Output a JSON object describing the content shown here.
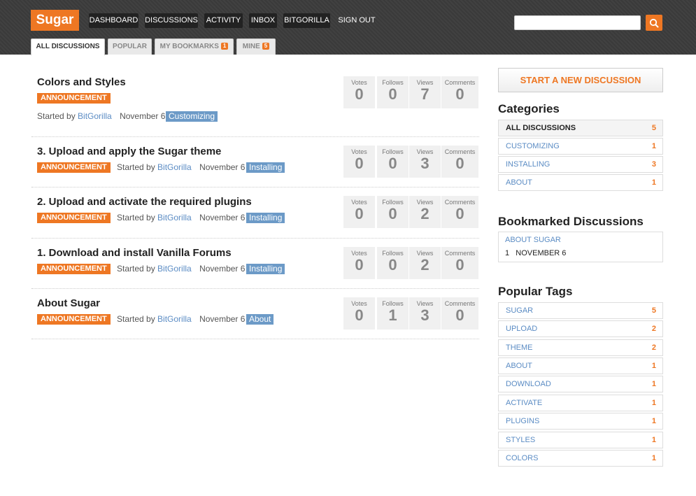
{
  "brand": {
    "logo": "Sugar",
    "accent": "#ee7723"
  },
  "nav": [
    {
      "label": "DASHBOARD"
    },
    {
      "label": "DISCUSSIONS"
    },
    {
      "label": "ACTIVITY"
    },
    {
      "label": "INBOX"
    },
    {
      "label": "BITGORILLA"
    },
    {
      "label": "SIGN OUT"
    }
  ],
  "search": {
    "placeholder": ""
  },
  "tabs": [
    {
      "label": "ALL DISCUSSIONS",
      "count": ""
    },
    {
      "label": "POPULAR",
      "count": ""
    },
    {
      "label": "MY BOOKMARKS",
      "count": "1"
    },
    {
      "label": "MINE",
      "count": "5"
    }
  ],
  "count_labels": {
    "votes": "Votes",
    "follows": "Follows",
    "views": "Views",
    "comments": "Comments"
  },
  "discussions": [
    {
      "title": "Colors and Styles",
      "badge": "ANNOUNCEMENT",
      "started_by": "Started by",
      "author": "BitGorilla",
      "date": "November 6",
      "category": "Customizing",
      "votes": "0",
      "follows": "0",
      "views": "7",
      "comments": "0"
    },
    {
      "title": "3. Upload and apply the Sugar theme",
      "badge": "ANNOUNCEMENT",
      "started_by": "Started by",
      "author": "BitGorilla",
      "date": "November 6",
      "category": "Installing",
      "votes": "0",
      "follows": "0",
      "views": "3",
      "comments": "0"
    },
    {
      "title": "2. Upload and activate the required plugins",
      "badge": "ANNOUNCEMENT",
      "started_by": "Started by",
      "author": "BitGorilla",
      "date": "November 6",
      "category": "Installing",
      "votes": "0",
      "follows": "0",
      "views": "2",
      "comments": "0"
    },
    {
      "title": "1. Download and install Vanilla Forums",
      "badge": "ANNOUNCEMENT",
      "started_by": "Started by",
      "author": "BitGorilla",
      "date": "November 6",
      "category": "Installing",
      "votes": "0",
      "follows": "0",
      "views": "2",
      "comments": "0"
    },
    {
      "title": "About Sugar",
      "badge": "ANNOUNCEMENT",
      "started_by": "Started by",
      "author": "BitGorilla",
      "date": "November 6",
      "category": "About",
      "votes": "0",
      "follows": "1",
      "views": "3",
      "comments": "0"
    }
  ],
  "sidebar": {
    "new_discussion": "START A NEW DISCUSSION",
    "categories_title": "Categories",
    "categories": [
      {
        "name": "ALL DISCUSSIONS",
        "count": "5"
      },
      {
        "name": "CUSTOMIZING",
        "count": "1"
      },
      {
        "name": "INSTALLING",
        "count": "3"
      },
      {
        "name": "ABOUT",
        "count": "1"
      }
    ],
    "bookmarked_title": "Bookmarked Discussions",
    "bookmarked": {
      "title": "ABOUT SUGAR",
      "count": "1",
      "date": "NOVEMBER 6"
    },
    "tags_title": "Popular Tags",
    "tags": [
      {
        "name": "SUGAR",
        "count": "5"
      },
      {
        "name": "UPLOAD",
        "count": "2"
      },
      {
        "name": "THEME",
        "count": "2"
      },
      {
        "name": "ABOUT",
        "count": "1"
      },
      {
        "name": "DOWNLOAD",
        "count": "1"
      },
      {
        "name": "ACTIVATE",
        "count": "1"
      },
      {
        "name": "PLUGINS",
        "count": "1"
      },
      {
        "name": "STYLES",
        "count": "1"
      },
      {
        "name": "COLORS",
        "count": "1"
      }
    ]
  }
}
